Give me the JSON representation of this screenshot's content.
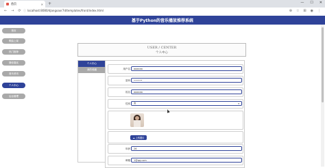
{
  "browser": {
    "tab_title": "首页",
    "tab_close": "✕",
    "new_tab": "+",
    "url": "localhost:8080/djangoaxr7d/templates/front/index.html",
    "window_controls": [
      "—",
      "☐",
      "✕"
    ],
    "nav_glyphs": [
      "←",
      "→",
      "⟳"
    ],
    "right_icons": [
      "⊕",
      "☆",
      "⊞",
      "◉",
      "⋮"
    ]
  },
  "header": {
    "title": "基于Python的音乐播放推荐系统"
  },
  "sidebar": {
    "items": [
      {
        "label": "首页",
        "active": false
      },
      {
        "label": "歌曲上架",
        "active": false
      },
      {
        "label": "热门推荐",
        "active": false
      },
      {
        "label": "猜你喜欢",
        "active": false
      },
      {
        "label": "音乐资讯",
        "active": false
      },
      {
        "label": "个人中心",
        "active": true
      },
      {
        "label": "后台管理",
        "active": false
      }
    ]
  },
  "banner": {
    "en": "USER / CENTER",
    "cn": "个人中心"
  },
  "subnav": {
    "items": [
      {
        "label": "个人中心",
        "active": true
      },
      {
        "label": "我的收藏",
        "active": false
      }
    ]
  },
  "form": {
    "username": {
      "label": "用户名",
      "value": "aaaaaa"
    },
    "password": {
      "label": "密码",
      "value": "••••••"
    },
    "name": {
      "label": "姓名",
      "value": "aaaaaa"
    },
    "gender": {
      "label": "性别",
      "value": "女",
      "caret": "▾"
    },
    "upload_label": "上传图片",
    "age": {
      "label": "年龄",
      "value": "26"
    },
    "email": {
      "label": "邮箱",
      "value": "1@qq.com"
    }
  },
  "colors": {
    "primary": "#2f4399",
    "inactive": "#a9a9a9"
  }
}
